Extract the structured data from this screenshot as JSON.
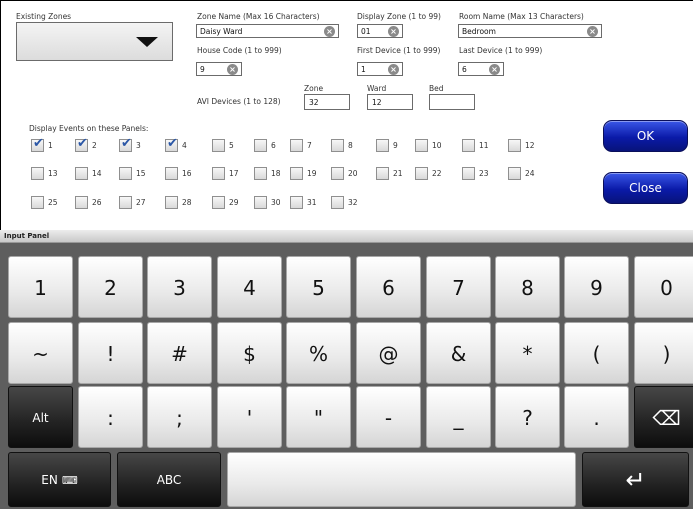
{
  "form": {
    "existing_zones_label": "Existing Zones",
    "zone_name_label": "Zone Name  (Max 16 Characters)",
    "zone_name_value": "Daisy Ward",
    "display_zone_label": "Display Zone (1 to 99)",
    "display_zone_value": "01",
    "room_name_label": "Room Name (Max 13 Characters)",
    "room_name_value": "Bedroom",
    "house_code_label": "House Code (1 to 999)",
    "house_code_value": "9",
    "first_device_label": "First Device (1 to 999)",
    "first_device_value": "1",
    "last_device_label": "Last Device (1 to 999)",
    "last_device_value": "6",
    "avi_label": "AVI Devices (1 to 128)",
    "avi_zone_label": "Zone",
    "avi_zone_value": "32",
    "avi_ward_label": "Ward",
    "avi_ward_value": "12",
    "avi_bed_label": "Bed",
    "avi_bed_value": "",
    "display_events_label": "Display Events on these Panels:",
    "clear_glyph": "×",
    "ok_label": "OK",
    "close_label": "Close",
    "panels": [
      {
        "n": "1",
        "checked": true
      },
      {
        "n": "2",
        "checked": true
      },
      {
        "n": "3",
        "checked": true
      },
      {
        "n": "4",
        "checked": true
      },
      {
        "n": "5",
        "checked": false
      },
      {
        "n": "6",
        "checked": false
      },
      {
        "n": "7",
        "checked": false
      },
      {
        "n": "8",
        "checked": false
      },
      {
        "n": "9",
        "checked": false
      },
      {
        "n": "10",
        "checked": false
      },
      {
        "n": "11",
        "checked": false
      },
      {
        "n": "12",
        "checked": false
      },
      {
        "n": "13",
        "checked": false
      },
      {
        "n": "14",
        "checked": false
      },
      {
        "n": "15",
        "checked": false
      },
      {
        "n": "16",
        "checked": false
      },
      {
        "n": "17",
        "checked": false
      },
      {
        "n": "18",
        "checked": false
      },
      {
        "n": "19",
        "checked": false
      },
      {
        "n": "20",
        "checked": false
      },
      {
        "n": "21",
        "checked": false
      },
      {
        "n": "22",
        "checked": false
      },
      {
        "n": "23",
        "checked": false
      },
      {
        "n": "24",
        "checked": false
      },
      {
        "n": "25",
        "checked": false
      },
      {
        "n": "26",
        "checked": false
      },
      {
        "n": "27",
        "checked": false
      },
      {
        "n": "28",
        "checked": false
      },
      {
        "n": "29",
        "checked": false
      },
      {
        "n": "30",
        "checked": false
      },
      {
        "n": "31",
        "checked": false
      },
      {
        "n": "32",
        "checked": false
      }
    ]
  },
  "keyboard": {
    "title": "Input Panel",
    "row1": [
      "1",
      "2",
      "3",
      "4",
      "5",
      "6",
      "7",
      "8",
      "9",
      "0"
    ],
    "row2": [
      "~",
      "!",
      "#",
      "$",
      "%",
      "@",
      "&",
      "*",
      "(",
      ")"
    ],
    "row3": [
      "Alt",
      ":",
      ";",
      "'",
      "\"",
      "-",
      "_",
      "?",
      ".",
      "⌫"
    ],
    "lang_label": "EN",
    "lang_icon": "keyboard-icon",
    "abc_label": "ABC",
    "space_label": "",
    "enter_glyph": "↵"
  }
}
